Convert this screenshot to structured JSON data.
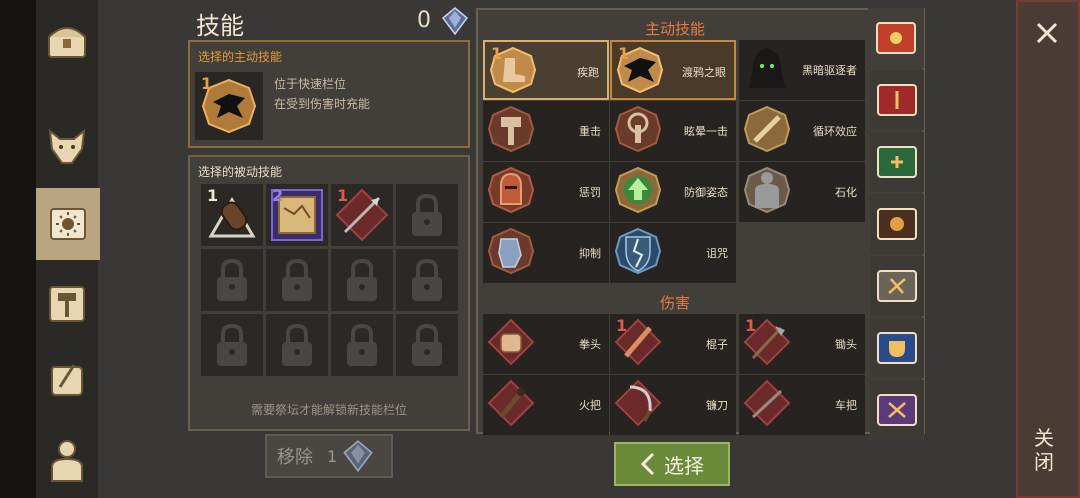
{
  "header": {
    "title": "技能",
    "currency_count": "0"
  },
  "active_panel": {
    "title": "选择的主动技能",
    "slot_number": "1",
    "line1": "位于快速栏位",
    "line2": "在受到伤害时充能"
  },
  "passive_panel": {
    "title": "选择的被动技能",
    "slots": [
      {
        "number": "1",
        "color": "#f0e6d2"
      },
      {
        "number": "2",
        "color": "#9a7cf0"
      },
      {
        "number": "1",
        "color": "#e05a4a"
      }
    ],
    "unlock_note": "需要祭坛才能解锁新技能栏位"
  },
  "remove_button": {
    "label": "移除",
    "count": "1"
  },
  "catalog": {
    "active_title": "主动技能",
    "active_skills": [
      {
        "label": "疾跑",
        "num": "1"
      },
      {
        "label": "渡鸦之眼",
        "num": "1"
      },
      {
        "label": "黑暗驱逐者",
        "num": ""
      },
      {
        "label": "重击",
        "num": ""
      },
      {
        "label": "眩晕一击",
        "num": ""
      },
      {
        "label": "循环效应",
        "num": ""
      },
      {
        "label": "惩罚",
        "num": ""
      },
      {
        "label": "防御姿态",
        "num": ""
      },
      {
        "label": "石化",
        "num": ""
      },
      {
        "label": "抑制",
        "num": ""
      },
      {
        "label": "诅咒",
        "num": ""
      }
    ],
    "damage_title": "伤害",
    "damage_skills": [
      {
        "label": "拳头",
        "num": ""
      },
      {
        "label": "棍子",
        "num": "1"
      },
      {
        "label": "锄头",
        "num": "1"
      },
      {
        "label": "火把",
        "num": ""
      },
      {
        "label": "镰刀",
        "num": ""
      },
      {
        "label": "车把",
        "num": ""
      }
    ]
  },
  "select_button": {
    "label": "选择"
  },
  "close": {
    "label": "关闭"
  },
  "colors": {
    "accent_orange": "#e29b3c",
    "section_red": "#ea7b3e",
    "select_green": "#6b8a3a"
  }
}
